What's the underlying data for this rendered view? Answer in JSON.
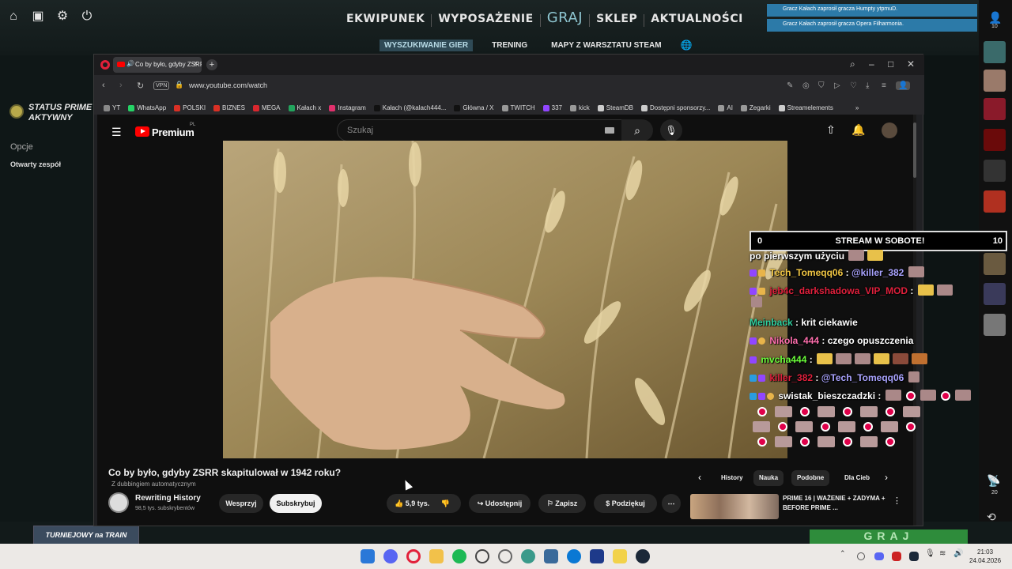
{
  "cs2": {
    "nav": [
      "EKWIPUNEK",
      "WYPOSAŻENIE",
      "GRAJ",
      "SKLEP",
      "AKTUALNOŚCI"
    ],
    "subnav": [
      "WYSZUKIWANIE GIER",
      "TRENING",
      "MAPY Z WARSZTATU STEAM"
    ],
    "prime_status_line1": "STATUS PRIME",
    "prime_status_line2": "AKTYWNY",
    "options_label": "Opcje",
    "team_label": "Otwarty zespół",
    "notifications": [
      "Gracz Kałach zaprosił gracza Humpty ytpmuD.",
      "Gracz Kałach zaprosił gracza Opera Filharmonia."
    ],
    "friends_count_top": "10",
    "side_count_1": "20",
    "side_count_2": "32",
    "tournament_label": "TURNIEJOWY na TRAIN",
    "play_button": "GRAJ"
  },
  "browser": {
    "tab_title": "Co by było, gdyby ZSRR",
    "url": "www.youtube.com/watch",
    "vpn_label": "VPN",
    "bookmarks": [
      {
        "label": "YT",
        "color": "#888"
      },
      {
        "label": "WhatsApp",
        "color": "#25d366"
      },
      {
        "label": "POLSKI",
        "color": "#d93025"
      },
      {
        "label": "BIZNES",
        "color": "#d93025"
      },
      {
        "label": "MEGA",
        "color": "#d9272e"
      },
      {
        "label": "Kałach x",
        "color": "#22a45d"
      },
      {
        "label": "Instagram",
        "color": "#e1306c"
      },
      {
        "label": "Kałach (@kalach444...",
        "color": "#111"
      },
      {
        "label": "Główna / X",
        "color": "#111"
      },
      {
        "label": "TWITCH",
        "color": "#999"
      },
      {
        "label": "337",
        "color": "#9146ff"
      },
      {
        "label": "kick",
        "color": "#999"
      },
      {
        "label": "SteamDB",
        "color": "#ccc"
      },
      {
        "label": "Dostępni sponsorzy...",
        "color": "#ccc"
      },
      {
        "label": "AI",
        "color": "#999"
      },
      {
        "label": "Zegarki",
        "color": "#999"
      },
      {
        "label": "Streamelements",
        "color": "#ccc"
      }
    ]
  },
  "youtube": {
    "brand": "Premium",
    "brand_region": "PL",
    "search_placeholder": "Szukaj",
    "video_title": "Co by było, gdyby ZSRR skapitulował w 1942 roku?",
    "dub_note": "Z dubbingiem automatycznym",
    "channel_name": "Rewriting History",
    "channel_subs": "98,5 tys. subskrybentów",
    "support_label": "Wesprzyj",
    "subscribe_label": "Subskrybuj",
    "likes": "5,9 tys.",
    "share_label": "Udostępnij",
    "save_label": "Zapisz",
    "thanks_label": "Podziękuj",
    "chips": [
      "History",
      "Nauka",
      "Podobne",
      "Dla Cieb"
    ],
    "rec_title": "PRIME 16 | WAŻENIE + ZADYMA + BEFORE PRIME ..."
  },
  "stream_overlay": {
    "banner_left": "0",
    "banner_center": "STREAM W SOBOTE!",
    "banner_right": "10",
    "chat": [
      {
        "user": "",
        "user_color": "#fff",
        "msg": "po pierwszym użyciu"
      },
      {
        "user": "Tech_Tomeqq06",
        "user_color": "#f2c744",
        "msg": "@killer_382",
        "msg_color": "#a9a3ff"
      },
      {
        "user": "jeb4c_darkshadowa_VIP_MOD",
        "user_color": "#e0203c",
        "msg": ""
      },
      {
        "user": "Meinback",
        "user_color": "#2fd1a0",
        "msg": "krit ciekawie"
      },
      {
        "user": "Nikola_444",
        "user_color": "#ff6fae",
        "msg": "czego opuszczenia"
      },
      {
        "user": "mvcha444",
        "user_color": "#6bff3b",
        "msg": ""
      },
      {
        "user": "killer_382",
        "user_color": "#e0203c",
        "msg": "@Tech_Tomeqq06",
        "msg_color": "#a9a3ff"
      },
      {
        "user": "swistak_bieszczadzki",
        "user_color": "#fff",
        "msg": ""
      }
    ]
  },
  "taskbar": {
    "time": "21:03",
    "date": "24.04.2026"
  }
}
